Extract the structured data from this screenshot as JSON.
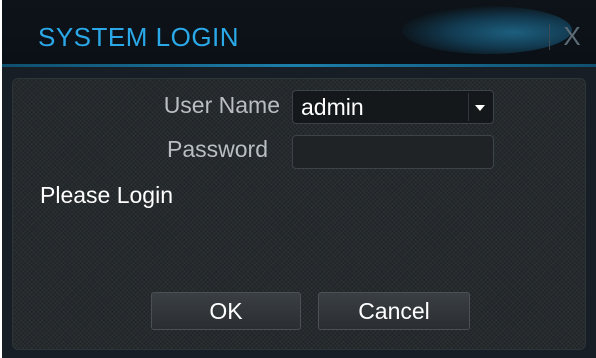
{
  "dialog": {
    "title": "SYSTEM LOGIN",
    "close_label": "X"
  },
  "form": {
    "username_label": "User Name",
    "username_value": "admin",
    "password_label": "Password",
    "password_value": ""
  },
  "status": {
    "message": "Please Login"
  },
  "buttons": {
    "ok_label": "OK",
    "cancel_label": "Cancel"
  },
  "colors": {
    "title_accent": "#2aa8e8",
    "window_bg": "#171e25",
    "panel_bg": "#202528"
  }
}
